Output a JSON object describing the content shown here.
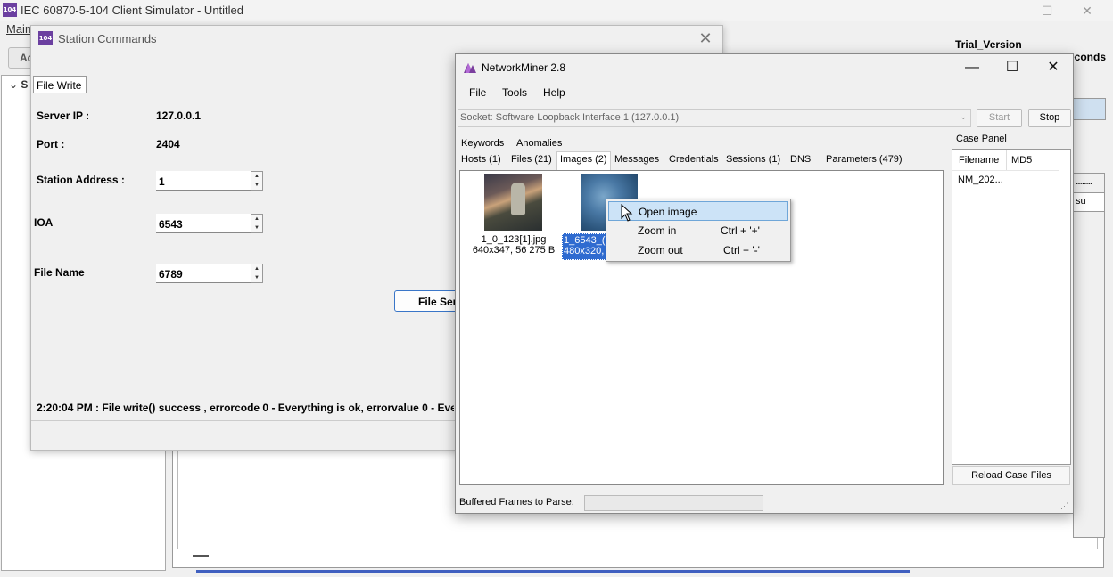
{
  "background_app": {
    "title": "IEC 60870-5-104 Client Simulator - Untitled",
    "icon_text": "104",
    "menu_label": "Main",
    "add_button_label": "Ad",
    "tree_expand_label": "S",
    "trial_label": "Trial_Version",
    "seconds_label": "econds",
    "right_cell_text": "su",
    "right_cell_dots": "..........",
    "window_controls": {
      "minimize": "—",
      "maximize": "☐",
      "close": "✕"
    }
  },
  "station_dialog": {
    "title": "Station Commands",
    "icon_text": "104",
    "close_glyph": "✕",
    "tab_label": "File Write",
    "fields": {
      "server_ip_label": "Server IP :",
      "server_ip_value": "127.0.0.1",
      "port_label": "Port :",
      "port_value": "2404",
      "station_address_label": "Station Address :",
      "station_address_value": "1",
      "ioa_label": "IOA",
      "ioa_value": "6543",
      "file_name_label": "File Name",
      "file_name_value": "6789"
    },
    "send_button_label": "File Sen",
    "status_text": "2:20:04 PM : File write() success , errorcode 0 - Everything is ok, errorvalue 0 - Ever"
  },
  "networkminer": {
    "title": "NetworkMiner 2.8",
    "window_controls": {
      "minimize": "—",
      "maximize": "☐",
      "close": "✕"
    },
    "menu": [
      "File",
      "Tools",
      "Help"
    ],
    "socket_value": "Socket: Software Loopback Interface 1 (127.0.0.1)",
    "start_label": "Start",
    "stop_label": "Stop",
    "tabs_row1": [
      "Keywords",
      "Anomalies"
    ],
    "tabs_row2": [
      "Hosts (1)",
      "Files (21)",
      "Images (2)",
      "Messages",
      "Credentials",
      "Sessions (1)",
      "DNS",
      "Parameters (479)"
    ],
    "active_tab": "Images (2)",
    "images": [
      {
        "name": "1_0_123[1].jpg",
        "info": "640x347, 56 275 B"
      },
      {
        "name": "1_6543_(",
        "info": "480x320,"
      }
    ],
    "case_panel": {
      "label": "Case Panel",
      "columns": [
        "Filename",
        "MD5"
      ],
      "rows": [
        "NM_202..."
      ],
      "reload_label": "Reload Case Files"
    },
    "buffered_label": "Buffered Frames to Parse:",
    "buffered_progress": 0,
    "accent_color": "#2f6bd0"
  },
  "context_menu": {
    "items": [
      {
        "label": "Open image",
        "shortcut": ""
      },
      {
        "label": "Zoom in",
        "shortcut": "Ctrl + '+'"
      },
      {
        "label": "Zoom out",
        "shortcut": "Ctrl + '-'"
      }
    ]
  }
}
